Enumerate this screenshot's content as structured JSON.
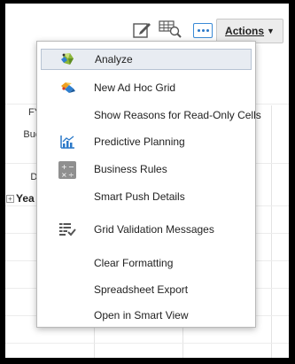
{
  "toolbar": {
    "actions_label": "Actions",
    "icons": [
      "edit-icon",
      "grid-search-icon",
      "more-icon"
    ]
  },
  "background_grid": {
    "row_labels": [
      "FY",
      "Bud",
      "Dr"
    ],
    "tree_row_label": "Yea"
  },
  "menu": {
    "items": [
      {
        "label": "Analyze",
        "icon": "analyze-icon",
        "highlighted": true
      },
      {
        "label": "New Ad Hoc Grid",
        "icon": "ad-hoc-grid-icon"
      },
      {
        "label": "Show Reasons for Read-Only Cells",
        "icon": null
      },
      {
        "label": "Predictive Planning",
        "icon": "predictive-planning-icon"
      },
      {
        "label": "Business Rules",
        "icon": "business-rules-icon"
      },
      {
        "label": "Smart Push Details",
        "icon": null
      },
      {
        "label": "Grid Validation Messages",
        "icon": "grid-validation-icon"
      },
      {
        "label": "Clear Formatting",
        "icon": null
      },
      {
        "label": "Spreadsheet Export",
        "icon": null
      },
      {
        "label": "Open in Smart View",
        "icon": null
      }
    ]
  },
  "colors": {
    "highlight_bg": "#e8ecf2",
    "accent_blue": "#2a78c8"
  }
}
